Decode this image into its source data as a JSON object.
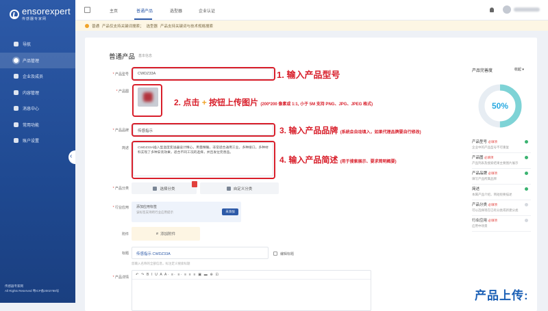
{
  "sidebar": {
    "logo_name": "ensorexpert",
    "logo_sub": "传感器专家网",
    "items": [
      {
        "label": "导航"
      },
      {
        "label": "产品管理"
      },
      {
        "label": "企业及成员"
      },
      {
        "label": "内容管理"
      },
      {
        "label": "消息中心"
      },
      {
        "label": "常用功能"
      },
      {
        "label": "账户设置"
      }
    ],
    "footer_line1": "传感器专家网",
    "footer_line2": "All Rights Reserved 粤ICP备2002788号"
  },
  "topbar": {
    "tabs": [
      {
        "label": "主页"
      },
      {
        "label": "普通产品"
      },
      {
        "label": "选型器"
      },
      {
        "label": "企业认证"
      }
    ]
  },
  "notice": {
    "tag": "普通",
    "text": "产品仅支持关键词搜索；",
    "tag2": "选型器",
    "text2": "产品支持关键词与技术规格搜索"
  },
  "form": {
    "title": "普通产品",
    "subtitle": "基本信息",
    "model_label": "产品型号",
    "model_value": "CWDZ33A",
    "image_label": "产品图",
    "brand_label": "产品品牌",
    "brand_value": "传感指示",
    "desc_label": "简述",
    "desc_value": "CWDZ33A插入型温度变送器设计精心，用量精确，非常适合通用工业，多种接口，多种材料实现了多种安装效果，适合不同工况的选择，并且发位完善品。",
    "category_label": "产品分类",
    "category_btn1": "选择分类",
    "category_btn2": "自定义分类",
    "industry_label": "行业应用",
    "industry_text": "添加应用标签",
    "industry_hint": "该标签支持跨行业应用提示",
    "industry_btn": "未添加",
    "attach_label": "附件",
    "attach_btn": "添加附件",
    "tag_label": "标题",
    "tag_value": "传感指示 CWDZ33A",
    "tag_check": "编辑标题",
    "tag_hint": "您输入名称的全部信息，标注定义搜索标题",
    "detail_label": "产品详情",
    "editor_toolbar": "↶ ↷  B I U A  A· ≡· ≡·  ≡ ≡ ≡  ▣ ▬ ⊕ ⊡"
  },
  "annotations": {
    "a1": "1. 输入产品型号",
    "a2_pre": "2. 点击",
    "a2_plus": "+",
    "a2_post": "按钮上传图片",
    "a2_small": "(200*200 像素或 1:1, 小于 5M 支持 PNG、JPG、JPEG 格式)",
    "a3": "3. 输入产品品牌",
    "a3_small": "(系统会自动填入，如果代理品牌要自行修改)",
    "a4": "4. 输入产品简述",
    "a4_small": "(用于搜索展示、要求简明概要)"
  },
  "panel": {
    "title": "产品完善度",
    "link": "收起",
    "percent": "50%",
    "percent_value": 50,
    "checks": [
      {
        "title": "产品型号",
        "req": "必填项",
        "desc": "企业中的产品型号不可重复",
        "done": true
      },
      {
        "title": "产品图",
        "req": "必填项",
        "desc": "产品列表及搜索结果主要图片展示",
        "done": true
      },
      {
        "title": "产品品牌",
        "req": "必填项",
        "desc": "填写产品所属品牌",
        "done": true
      },
      {
        "title": "简述",
        "req": "",
        "desc": "本属产品介绍，简短扼要描述",
        "done": true
      },
      {
        "title": "产品分类",
        "req": "必填项",
        "desc": "可以选择现在已有分类或新建分类",
        "done": false
      },
      {
        "title": "行业应用",
        "req": "必填项",
        "desc": "应用中场景",
        "done": false
      }
    ]
  },
  "watermark": "产品上传:",
  "colors": {
    "accent": "#2d5aa8",
    "annotation": "#d81e2a",
    "progress": "#27a9e1"
  }
}
